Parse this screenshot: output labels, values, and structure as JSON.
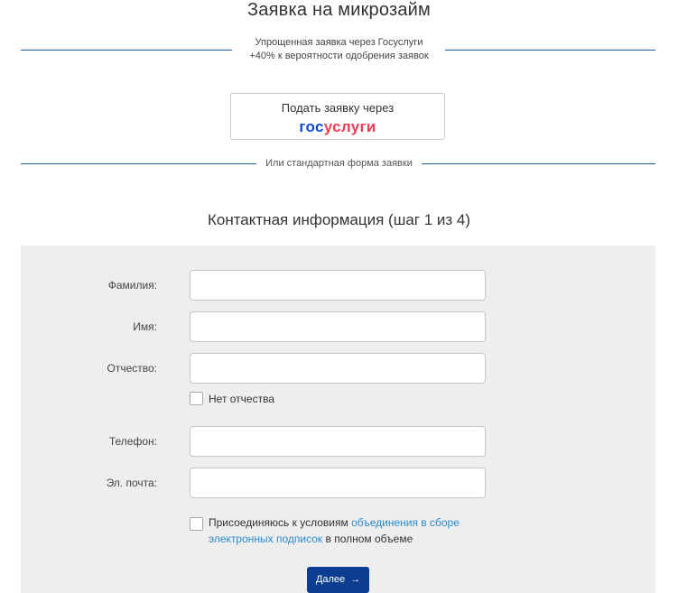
{
  "page": {
    "title": "Заявка на микрозайм",
    "subtitle_line1": "Упрощенная заявка через Госуслуги",
    "subtitle_line2": "+40% к вероятности одобрения заявок",
    "gosuslugi_button": {
      "label": "Подать заявку через",
      "logo_part1": "гос",
      "logo_part2": "услуги"
    },
    "alt_text": "Или стандартная форма заявки",
    "step_title": "Контактная информация (шаг 1 из 4)"
  },
  "form": {
    "fields": {
      "lastname": {
        "label": "Фамилия:",
        "value": ""
      },
      "firstname": {
        "label": "Имя:",
        "value": ""
      },
      "middlename": {
        "label": "Отчество:",
        "value": ""
      },
      "phone": {
        "label": "Телефон:",
        "value": ""
      },
      "email": {
        "label": "Эл. почта:",
        "value": ""
      }
    },
    "no_middlename_label": "Нет отчества",
    "agree": {
      "text_before": "Присоединяюсь к условиям ",
      "link_line1": "объединения в сборе",
      "link_line2": "электронных подписок",
      "text_after": " в полном объеме"
    },
    "next_label": "Далее",
    "next_icon": "arrow-right-icon"
  },
  "colors": {
    "separator": "#1f5fa0",
    "gos_blue": "#0d4cd3",
    "gos_red": "#ee3f58",
    "link": "#2a8bd0",
    "button": "#0b3d91",
    "panel": "#eeeeee"
  }
}
